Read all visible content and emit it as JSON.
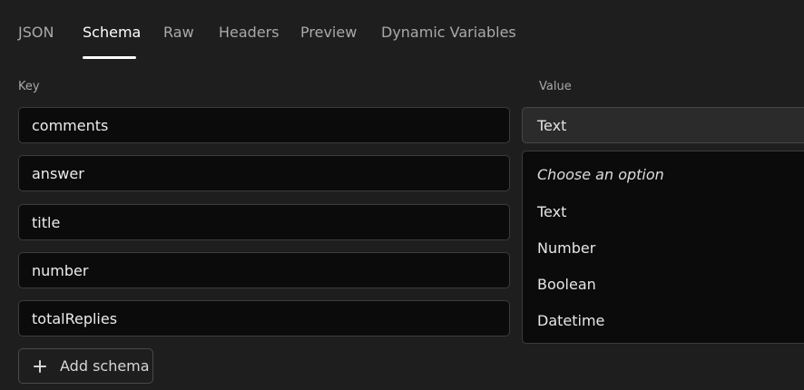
{
  "tabs": [
    {
      "label": "JSON"
    },
    {
      "label": "Schema"
    },
    {
      "label": "Raw"
    },
    {
      "label": "Headers"
    },
    {
      "label": "Preview"
    },
    {
      "label": "Dynamic Variables"
    }
  ],
  "active_tab": "Schema",
  "columns": {
    "key_label": "Key",
    "value_label": "Value"
  },
  "rows": [
    {
      "key": "comments"
    },
    {
      "key": "answer"
    },
    {
      "key": "title"
    },
    {
      "key": "number"
    },
    {
      "key": "totalReplies"
    }
  ],
  "value_select": {
    "selected": "Text"
  },
  "dropdown": {
    "placeholder": "Choose an option",
    "options": [
      "Text",
      "Number",
      "Boolean",
      "Datetime"
    ]
  },
  "add_button": {
    "label": "Add schema",
    "icon": "plus-icon"
  }
}
